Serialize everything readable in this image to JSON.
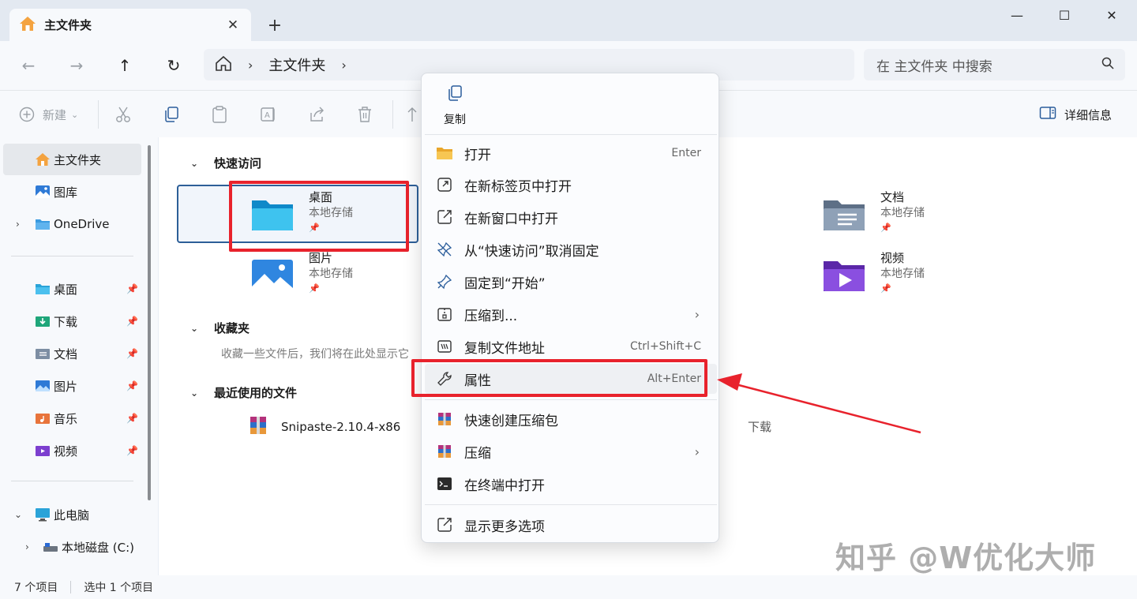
{
  "window": {
    "tab_title": "主文件夹",
    "new_tab_label": "+",
    "minimize": "—",
    "maximize": "☐",
    "close": "✕"
  },
  "address": {
    "crumb": "主文件夹",
    "search_placeholder": "在 主文件夹 中搜索"
  },
  "toolbar": {
    "new_label": "新建",
    "details_label": "详细信息"
  },
  "sidebar": {
    "home": "主文件夹",
    "gallery": "图库",
    "onedrive": "OneDrive",
    "pinned": [
      {
        "label": "桌面"
      },
      {
        "label": "下载"
      },
      {
        "label": "文档"
      },
      {
        "label": "图片"
      },
      {
        "label": "音乐"
      },
      {
        "label": "视频"
      }
    ],
    "this_pc": "此电脑",
    "local_disk": "本地磁盘 (C:)"
  },
  "content": {
    "quick_access": "快速访问",
    "favorites": "收藏夹",
    "favorites_hint": "收藏一些文件后，我们将在此处显示它",
    "recent": "最近使用的文件",
    "tiles": [
      {
        "name": "桌面",
        "sub": "本地存储"
      },
      {
        "name": "图片",
        "sub": "本地存储"
      },
      {
        "name": "文档",
        "sub": "本地存储"
      },
      {
        "name": "视频",
        "sub": "本地存储"
      }
    ],
    "recent_file": {
      "name": "Snipaste-2.10.4-x86",
      "location": "下载"
    }
  },
  "status": {
    "count": "7 个项目",
    "selected": "选中 1 个项目"
  },
  "context_menu": {
    "copy_label": "复制",
    "items": [
      {
        "label": "打开",
        "shortcut": "Enter"
      },
      {
        "label": "在新标签页中打开",
        "shortcut": ""
      },
      {
        "label": "在新窗口中打开",
        "shortcut": ""
      },
      {
        "label": "从“快速访问”取消固定",
        "shortcut": ""
      },
      {
        "label": "固定到“开始”",
        "shortcut": ""
      },
      {
        "label": "压缩到...",
        "shortcut": ""
      },
      {
        "label": "复制文件地址",
        "shortcut": "Ctrl+Shift+C"
      },
      {
        "label": "属性",
        "shortcut": "Alt+Enter"
      },
      {
        "label": "快速创建压缩包",
        "shortcut": ""
      },
      {
        "label": "压缩",
        "shortcut": ""
      },
      {
        "label": "在终端中打开",
        "shortcut": ""
      },
      {
        "label": "显示更多选项",
        "shortcut": ""
      }
    ]
  },
  "watermark": "知乎 @W优化大师",
  "colors": {
    "annotation_red": "#e8222c",
    "selection_blue": "#2d5f98"
  }
}
